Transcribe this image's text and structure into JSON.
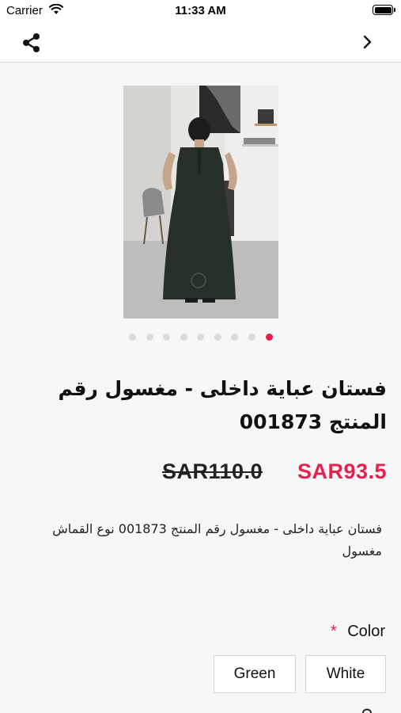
{
  "status_bar": {
    "carrier": "Carrier",
    "time": "11:33 AM"
  },
  "nav": {
    "share_icon": "share-icon",
    "forward_icon": "chevron-right-icon"
  },
  "gallery": {
    "image_alt": "product photo: woman in dark green sleeveless abaya dress",
    "dot_count": 9,
    "active_dot_index": 8,
    "active_color": "#e8204f"
  },
  "product": {
    "title": "فستان عباية داخلى - مغسول  رقم المنتج 001873",
    "price_old": "SAR110.0",
    "price_new": "SAR93.5",
    "description": "فستان عباية داخلى - مغسول رقم المنتج 001873 نوع القماش مغسول"
  },
  "options": {
    "label": "Color",
    "required_mark": "*",
    "values": [
      "White",
      "Green"
    ]
  },
  "colors": {
    "accent": "#e8204f",
    "dress": "#263027"
  }
}
